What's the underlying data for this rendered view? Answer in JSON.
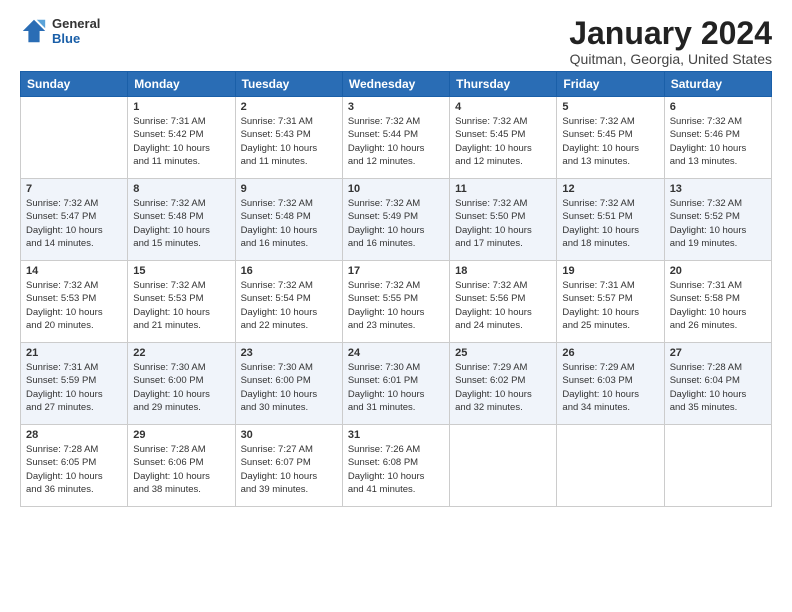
{
  "header": {
    "logo_general": "General",
    "logo_blue": "Blue",
    "month": "January 2024",
    "location": "Quitman, Georgia, United States"
  },
  "weekdays": [
    "Sunday",
    "Monday",
    "Tuesday",
    "Wednesday",
    "Thursday",
    "Friday",
    "Saturday"
  ],
  "weeks": [
    [
      {
        "day": "",
        "info": ""
      },
      {
        "day": "1",
        "info": "Sunrise: 7:31 AM\nSunset: 5:42 PM\nDaylight: 10 hours\nand 11 minutes."
      },
      {
        "day": "2",
        "info": "Sunrise: 7:31 AM\nSunset: 5:43 PM\nDaylight: 10 hours\nand 11 minutes."
      },
      {
        "day": "3",
        "info": "Sunrise: 7:32 AM\nSunset: 5:44 PM\nDaylight: 10 hours\nand 12 minutes."
      },
      {
        "day": "4",
        "info": "Sunrise: 7:32 AM\nSunset: 5:45 PM\nDaylight: 10 hours\nand 12 minutes."
      },
      {
        "day": "5",
        "info": "Sunrise: 7:32 AM\nSunset: 5:45 PM\nDaylight: 10 hours\nand 13 minutes."
      },
      {
        "day": "6",
        "info": "Sunrise: 7:32 AM\nSunset: 5:46 PM\nDaylight: 10 hours\nand 13 minutes."
      }
    ],
    [
      {
        "day": "7",
        "info": "Sunrise: 7:32 AM\nSunset: 5:47 PM\nDaylight: 10 hours\nand 14 minutes."
      },
      {
        "day": "8",
        "info": "Sunrise: 7:32 AM\nSunset: 5:48 PM\nDaylight: 10 hours\nand 15 minutes."
      },
      {
        "day": "9",
        "info": "Sunrise: 7:32 AM\nSunset: 5:48 PM\nDaylight: 10 hours\nand 16 minutes."
      },
      {
        "day": "10",
        "info": "Sunrise: 7:32 AM\nSunset: 5:49 PM\nDaylight: 10 hours\nand 16 minutes."
      },
      {
        "day": "11",
        "info": "Sunrise: 7:32 AM\nSunset: 5:50 PM\nDaylight: 10 hours\nand 17 minutes."
      },
      {
        "day": "12",
        "info": "Sunrise: 7:32 AM\nSunset: 5:51 PM\nDaylight: 10 hours\nand 18 minutes."
      },
      {
        "day": "13",
        "info": "Sunrise: 7:32 AM\nSunset: 5:52 PM\nDaylight: 10 hours\nand 19 minutes."
      }
    ],
    [
      {
        "day": "14",
        "info": "Sunrise: 7:32 AM\nSunset: 5:53 PM\nDaylight: 10 hours\nand 20 minutes."
      },
      {
        "day": "15",
        "info": "Sunrise: 7:32 AM\nSunset: 5:53 PM\nDaylight: 10 hours\nand 21 minutes."
      },
      {
        "day": "16",
        "info": "Sunrise: 7:32 AM\nSunset: 5:54 PM\nDaylight: 10 hours\nand 22 minutes."
      },
      {
        "day": "17",
        "info": "Sunrise: 7:32 AM\nSunset: 5:55 PM\nDaylight: 10 hours\nand 23 minutes."
      },
      {
        "day": "18",
        "info": "Sunrise: 7:32 AM\nSunset: 5:56 PM\nDaylight: 10 hours\nand 24 minutes."
      },
      {
        "day": "19",
        "info": "Sunrise: 7:31 AM\nSunset: 5:57 PM\nDaylight: 10 hours\nand 25 minutes."
      },
      {
        "day": "20",
        "info": "Sunrise: 7:31 AM\nSunset: 5:58 PM\nDaylight: 10 hours\nand 26 minutes."
      }
    ],
    [
      {
        "day": "21",
        "info": "Sunrise: 7:31 AM\nSunset: 5:59 PM\nDaylight: 10 hours\nand 27 minutes."
      },
      {
        "day": "22",
        "info": "Sunrise: 7:30 AM\nSunset: 6:00 PM\nDaylight: 10 hours\nand 29 minutes."
      },
      {
        "day": "23",
        "info": "Sunrise: 7:30 AM\nSunset: 6:00 PM\nDaylight: 10 hours\nand 30 minutes."
      },
      {
        "day": "24",
        "info": "Sunrise: 7:30 AM\nSunset: 6:01 PM\nDaylight: 10 hours\nand 31 minutes."
      },
      {
        "day": "25",
        "info": "Sunrise: 7:29 AM\nSunset: 6:02 PM\nDaylight: 10 hours\nand 32 minutes."
      },
      {
        "day": "26",
        "info": "Sunrise: 7:29 AM\nSunset: 6:03 PM\nDaylight: 10 hours\nand 34 minutes."
      },
      {
        "day": "27",
        "info": "Sunrise: 7:28 AM\nSunset: 6:04 PM\nDaylight: 10 hours\nand 35 minutes."
      }
    ],
    [
      {
        "day": "28",
        "info": "Sunrise: 7:28 AM\nSunset: 6:05 PM\nDaylight: 10 hours\nand 36 minutes."
      },
      {
        "day": "29",
        "info": "Sunrise: 7:28 AM\nSunset: 6:06 PM\nDaylight: 10 hours\nand 38 minutes."
      },
      {
        "day": "30",
        "info": "Sunrise: 7:27 AM\nSunset: 6:07 PM\nDaylight: 10 hours\nand 39 minutes."
      },
      {
        "day": "31",
        "info": "Sunrise: 7:26 AM\nSunset: 6:08 PM\nDaylight: 10 hours\nand 41 minutes."
      },
      {
        "day": "",
        "info": ""
      },
      {
        "day": "",
        "info": ""
      },
      {
        "day": "",
        "info": ""
      }
    ]
  ]
}
